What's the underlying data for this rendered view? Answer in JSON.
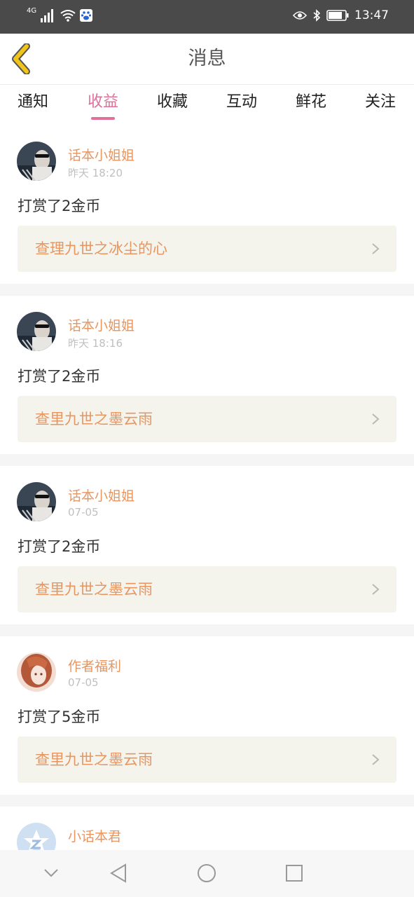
{
  "status_bar": {
    "network": "4G",
    "time": "13:47",
    "icons": [
      "signal-icon",
      "wifi-icon",
      "baidu-paw-icon",
      "eye-icon",
      "bluetooth-icon",
      "battery-icon"
    ]
  },
  "header": {
    "title": "消息",
    "back_icon": "chevron-left-icon",
    "accent_color": "#f0c419"
  },
  "tabs": [
    {
      "label": "通知",
      "active": false
    },
    {
      "label": "收益",
      "active": true
    },
    {
      "label": "收藏",
      "active": false
    },
    {
      "label": "互动",
      "active": false
    },
    {
      "label": "鲜花",
      "active": false
    },
    {
      "label": "关注",
      "active": false
    }
  ],
  "colors": {
    "active_tab": "#e0709a",
    "sender": "#e8955f",
    "work_link_bg": "#f4f4ec"
  },
  "messages": [
    {
      "sender": "话本小姐姐",
      "time": "昨天 18:20",
      "text": "打赏了2金币",
      "work": "查理九世之冰尘的心",
      "avatar": "photo-avatar"
    },
    {
      "sender": "话本小姐姐",
      "time": "昨天 18:16",
      "text": "打赏了2金币",
      "work": "查里九世之墨云雨",
      "avatar": "photo-avatar"
    },
    {
      "sender": "话本小姐姐",
      "time": "07-05",
      "text": "打赏了2金币",
      "work": "查里九世之墨云雨",
      "avatar": "photo-avatar"
    },
    {
      "sender": "作者福利",
      "time": "07-05",
      "text": "打赏了5金币",
      "work": "查里九世之墨云雨",
      "avatar": "anime-avatar"
    },
    {
      "sender": "小话本君",
      "time": "",
      "text": "",
      "work": "",
      "avatar": "logo-avatar"
    }
  ],
  "nav_bar": {
    "icons": [
      "collapse-chevron-icon",
      "back-triangle-icon",
      "home-circle-icon",
      "recents-square-icon"
    ]
  }
}
